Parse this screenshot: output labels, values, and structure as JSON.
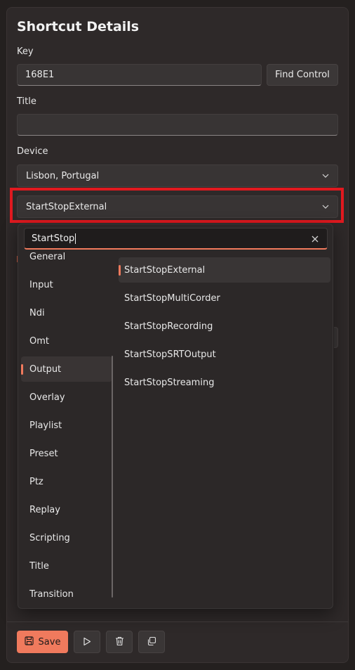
{
  "panel": {
    "title": "Shortcut Details"
  },
  "form": {
    "key_label": "Key",
    "key_value": "168E1",
    "find_control_label": "Find Control",
    "title_label": "Title",
    "title_value": "",
    "device_label": "Device",
    "device_value": "Lisbon, Portugal",
    "function_value": "StartStopExternal"
  },
  "picker": {
    "search_value": "StartStop",
    "categories": [
      "General",
      "Input",
      "Ndi",
      "Omt",
      "Output",
      "Overlay",
      "Playlist",
      "Preset",
      "Ptz",
      "Replay",
      "Scripting",
      "Title",
      "Transition"
    ],
    "selected_category": "Output",
    "controls": [
      "StartStopExternal",
      "StartStopMultiCorder",
      "StartStopRecording",
      "StartStopSRTOutput",
      "StartStopStreaming"
    ],
    "selected_control": "StartStopExternal"
  },
  "footer": {
    "save_label": "Save"
  },
  "colors": {
    "accent": "#f07a5d",
    "highlight": "#e0191f",
    "background": "#2e2929"
  },
  "icons": [
    "chevron-down-icon",
    "clear-icon",
    "save-icon",
    "play-icon",
    "trash-icon",
    "copy-icon"
  ]
}
